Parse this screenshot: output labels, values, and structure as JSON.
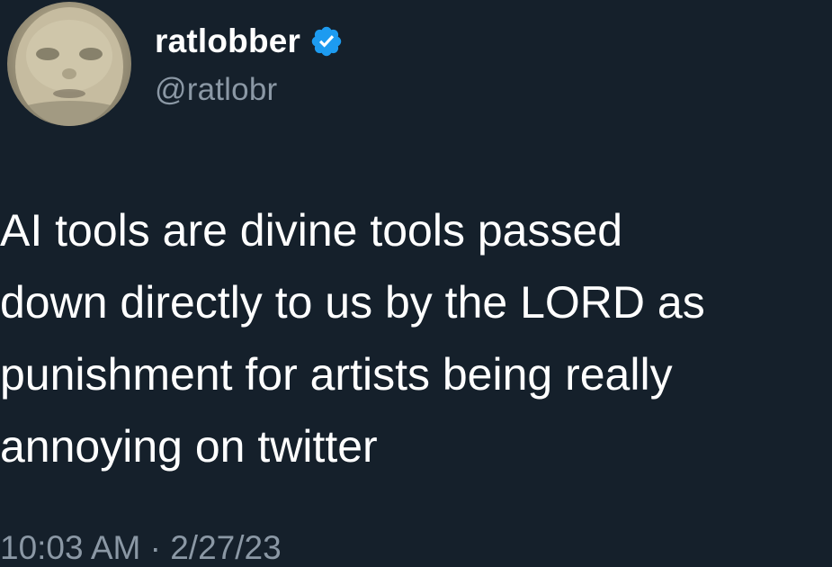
{
  "author": {
    "display_name": "ratlobber",
    "handle": "@ratlobr",
    "verified": true,
    "verified_color": "#1d9bf0",
    "avatar_icon": "blurry-face-avatar"
  },
  "tweet": {
    "text": "AI tools are divine tools passed\ndown directly to us by the LORD as\npunishment for artists being really\nannoying on twitter",
    "time": "10:03 AM",
    "separator": "·",
    "date": "2/27/23"
  },
  "theme": {
    "background": "#15202b",
    "text": "#ffffff",
    "secondary_text": "#8b98a5"
  }
}
